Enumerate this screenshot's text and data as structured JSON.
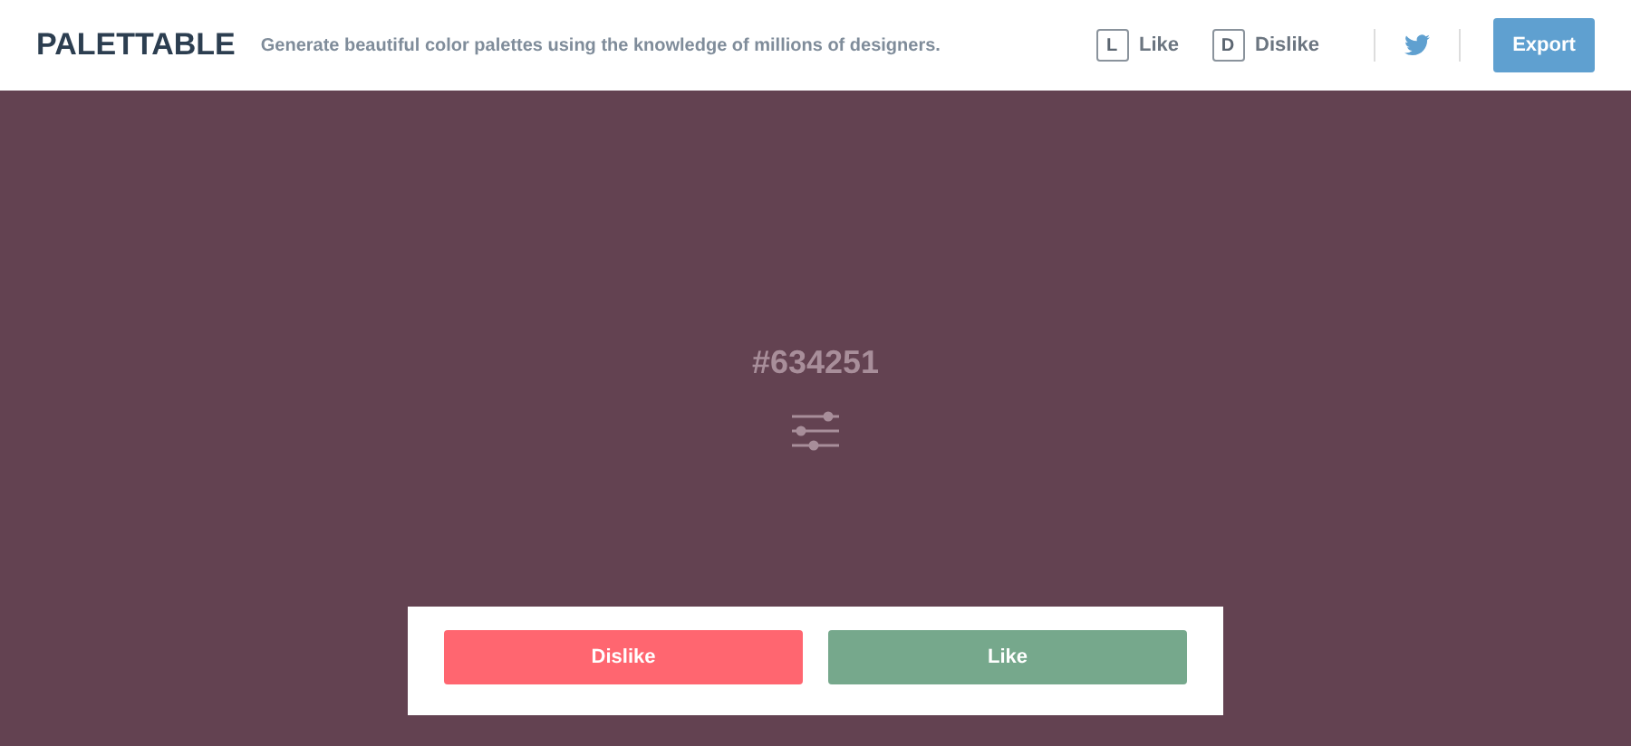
{
  "header": {
    "logo": "PALETTABLE",
    "tagline": "Generate beautiful color palettes using the knowledge of millions of designers.",
    "shortcuts": [
      {
        "key": "L",
        "label": "Like"
      },
      {
        "key": "D",
        "label": "Dislike"
      }
    ],
    "export_button": "Export"
  },
  "swatch": {
    "hex": "#634251"
  },
  "actions": [
    {
      "label": "Dislike",
      "kind": "dislike"
    },
    {
      "label": "Like",
      "kind": "like"
    }
  ]
}
